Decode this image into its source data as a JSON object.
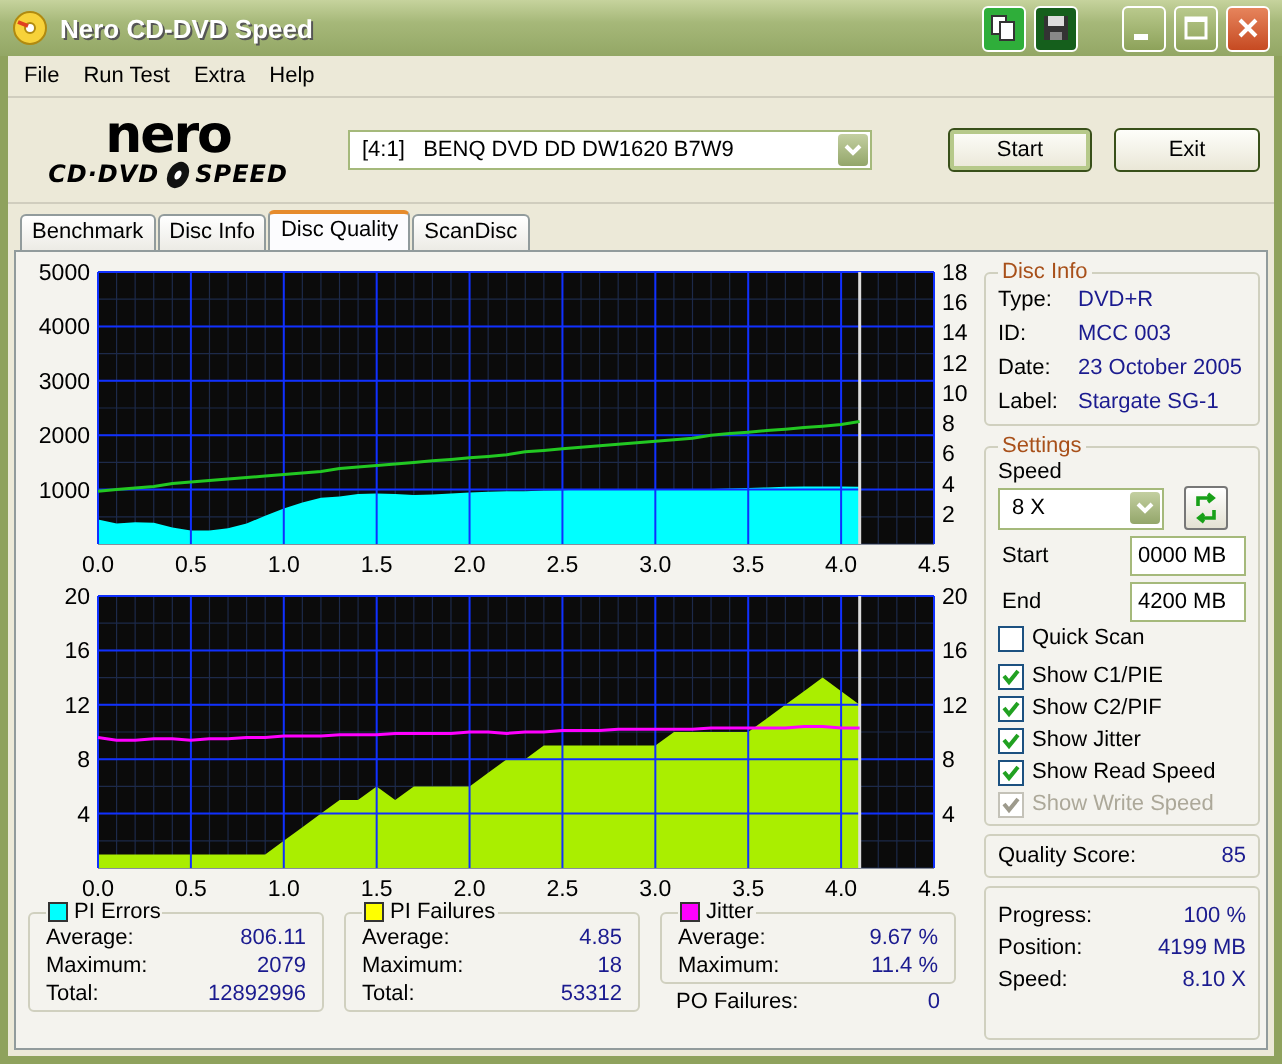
{
  "window": {
    "title": "Nero CD-DVD Speed"
  },
  "menu": [
    "File",
    "Run Test",
    "Extra",
    "Help"
  ],
  "logo": {
    "brand": "nero",
    "product_left": "CD·DVD",
    "product_right": "SPEED"
  },
  "drive": {
    "value": "[4:1]   BENQ DVD DD DW1620 B7W9"
  },
  "buttons": [
    "Start",
    "Exit"
  ],
  "tabs": [
    {
      "label": "Benchmark",
      "selected": false
    },
    {
      "label": "Disc Info",
      "selected": false
    },
    {
      "label": "Disc Quality",
      "selected": true
    },
    {
      "label": "ScanDisc",
      "selected": false
    }
  ],
  "charts": [
    {
      "chart_data": {
        "type": "area",
        "grid": true,
        "ref_lines": [
          {
            "axis": "x",
            "value": 4.1,
            "color": "#dddddd"
          }
        ],
        "xlim": [
          0,
          4.5
        ],
        "ylim": [
          0,
          5000
        ],
        "y2lim": [
          0,
          18
        ],
        "xticks": [
          {
            "value": 0,
            "label": "0.0"
          },
          {
            "value": 0.5,
            "label": "0.5"
          },
          {
            "value": 1,
            "label": "1.0"
          },
          {
            "value": 1.5,
            "label": "1.5"
          },
          {
            "value": 2,
            "label": "2.0"
          },
          {
            "value": 2.5,
            "label": "2.5"
          },
          {
            "value": 3,
            "label": "3.0"
          },
          {
            "value": 3.5,
            "label": "3.5"
          },
          {
            "value": 4,
            "label": "4.0"
          },
          {
            "value": 4.5,
            "label": "4.5"
          }
        ],
        "yticks": [
          1000,
          2000,
          3000,
          4000,
          5000
        ],
        "y2ticks": [
          2,
          4,
          6,
          8,
          10,
          12,
          14,
          16,
          18
        ],
        "x": [
          0,
          0.1,
          0.2,
          0.3,
          0.4,
          0.5,
          0.6,
          0.7,
          0.8,
          0.9,
          1,
          1.1,
          1.2,
          1.3,
          1.4,
          1.5,
          1.6,
          1.7,
          1.8,
          1.9,
          2,
          2.1,
          2.2,
          2.3,
          2.4,
          2.5,
          2.6,
          2.7,
          2.8,
          2.9,
          3,
          3.1,
          3.2,
          3.3,
          3.4,
          3.5,
          3.6,
          3.7,
          3.8,
          3.9,
          4,
          4.1
        ],
        "series": [
          {
            "color": "#00ffff",
            "values": [
              450,
              380,
              400,
              390,
              300,
              250,
              250,
              290,
              380,
              520,
              650,
              760,
              850,
              870,
              920,
              930,
              920,
              900,
              910,
              930,
              950,
              960,
              970,
              970,
              980,
              990,
              1000,
              1000,
              1000,
              1000,
              1000,
              1000,
              1010,
              1010,
              1020,
              1030,
              1040,
              1050,
              1060,
              1060,
              1060,
              1050
            ]
          },
          {
            "type": "line",
            "axis": "y2",
            "color": "#22c822",
            "values": [
              3.5,
              3.6,
              3.7,
              3.8,
              4.0,
              4.1,
              4.2,
              4.3,
              4.4,
              4.5,
              4.6,
              4.7,
              4.8,
              5.0,
              5.1,
              5.2,
              5.3,
              5.4,
              5.5,
              5.6,
              5.7,
              5.8,
              5.9,
              6.1,
              6.2,
              6.3,
              6.4,
              6.5,
              6.6,
              6.7,
              6.8,
              6.9,
              7.0,
              7.2,
              7.3,
              7.4,
              7.5,
              7.6,
              7.7,
              7.8,
              7.9,
              8.1
            ]
          }
        ]
      }
    },
    {
      "chart_data": {
        "type": "area",
        "grid": true,
        "ref_lines": [
          {
            "axis": "x",
            "value": 4.1,
            "color": "#dddddd"
          }
        ],
        "xlim": [
          0,
          4.5
        ],
        "ylim": [
          0,
          20
        ],
        "y2lim": [
          0,
          20
        ],
        "xticks": [
          {
            "value": 0,
            "label": "0.0"
          },
          {
            "value": 0.5,
            "label": "0.5"
          },
          {
            "value": 1,
            "label": "1.0"
          },
          {
            "value": 1.5,
            "label": "1.5"
          },
          {
            "value": 2,
            "label": "2.0"
          },
          {
            "value": 2.5,
            "label": "2.5"
          },
          {
            "value": 3,
            "label": "3.0"
          },
          {
            "value": 3.5,
            "label": "3.5"
          },
          {
            "value": 4,
            "label": "4.0"
          },
          {
            "value": 4.5,
            "label": "4.5"
          }
        ],
        "yticks": [
          4,
          8,
          12,
          16,
          20
        ],
        "y2ticks": [
          4,
          8,
          12,
          16,
          20
        ],
        "x": [
          0,
          0.1,
          0.2,
          0.3,
          0.4,
          0.5,
          0.6,
          0.7,
          0.8,
          0.9,
          1,
          1.1,
          1.2,
          1.3,
          1.4,
          1.5,
          1.6,
          1.7,
          1.8,
          1.9,
          2,
          2.1,
          2.2,
          2.3,
          2.4,
          2.5,
          2.6,
          2.7,
          2.8,
          2.9,
          3,
          3.1,
          3.2,
          3.3,
          3.4,
          3.5,
          3.6,
          3.7,
          3.8,
          3.9,
          4,
          4.1
        ],
        "series": [
          {
            "color": "#aaee00",
            "values": [
              1,
              1,
              1,
              1,
              1,
              1,
              1,
              1,
              1,
              1,
              2,
              3,
              4,
              5,
              5,
              6,
              5,
              6,
              6,
              6,
              6,
              7,
              8,
              8,
              9,
              9,
              9,
              9,
              9,
              9,
              9,
              10,
              10,
              10,
              10,
              10,
              11,
              12,
              13,
              14,
              13,
              12
            ]
          },
          {
            "type": "line",
            "axis": "y2",
            "color": "#ff00ff",
            "values": [
              9.6,
              9.4,
              9.4,
              9.5,
              9.5,
              9.4,
              9.5,
              9.5,
              9.6,
              9.6,
              9.7,
              9.7,
              9.7,
              9.8,
              9.8,
              9.8,
              9.9,
              9.9,
              9.9,
              9.9,
              10.0,
              10.0,
              9.9,
              10.0,
              10.0,
              10.1,
              10.1,
              10.1,
              10.2,
              10.2,
              10.2,
              10.2,
              10.2,
              10.3,
              10.3,
              10.3,
              10.3,
              10.3,
              10.4,
              10.4,
              10.3,
              10.3
            ]
          }
        ]
      }
    }
  ],
  "disc_info": {
    "title": "Disc Info",
    "fields": [
      {
        "label": "Type:",
        "value": "DVD+R"
      },
      {
        "label": "ID:",
        "value": "MCC 003"
      },
      {
        "label": "Date:",
        "value": "23 October 2005"
      },
      {
        "label": "Label:",
        "value": "Stargate SG-1"
      }
    ]
  },
  "settings": {
    "title": "Settings",
    "speed_label": "Speed",
    "speed": "8 X",
    "start_label": "Start",
    "start": "0000 MB",
    "end_label": "End",
    "end": "4200 MB",
    "options": [
      {
        "label": "Quick Scan",
        "checked": false,
        "disabled": false
      },
      {
        "label": "Show C1/PIE",
        "checked": true,
        "disabled": false
      },
      {
        "label": "Show C2/PIF",
        "checked": true,
        "disabled": false
      },
      {
        "label": "Show Jitter",
        "checked": true,
        "disabled": false
      },
      {
        "label": "Show Read Speed",
        "checked": true,
        "disabled": false
      },
      {
        "label": "Show Write Speed",
        "checked": true,
        "disabled": true
      }
    ]
  },
  "quality": {
    "label": "Quality Score:",
    "value": "85"
  },
  "stats": [
    {
      "title": "PI Errors",
      "color": "#00ffff",
      "rows": [
        {
          "label": "Average:",
          "value": "806.11"
        },
        {
          "label": "Maximum:",
          "value": "2079"
        },
        {
          "label": "Total:",
          "value": "12892996"
        }
      ]
    },
    {
      "title": "PI Failures",
      "color": "#ffff00",
      "rows": [
        {
          "label": "Average:",
          "value": "4.85"
        },
        {
          "label": "Maximum:",
          "value": "18"
        },
        {
          "label": "Total:",
          "value": "53312"
        }
      ]
    },
    {
      "title": "Jitter",
      "color": "#ff00ff",
      "rows": [
        {
          "label": "Average:",
          "value": "9.67 %"
        },
        {
          "label": "Maximum:",
          "value": "11.4 %"
        }
      ]
    }
  ],
  "po_failures": {
    "label": "PO Failures:",
    "value": "0"
  },
  "progress": [
    {
      "label": "Progress:",
      "value": "100 %"
    },
    {
      "label": "Position:",
      "value": "4199 MB"
    },
    {
      "label": "Speed:",
      "value": "8.10 X"
    }
  ]
}
